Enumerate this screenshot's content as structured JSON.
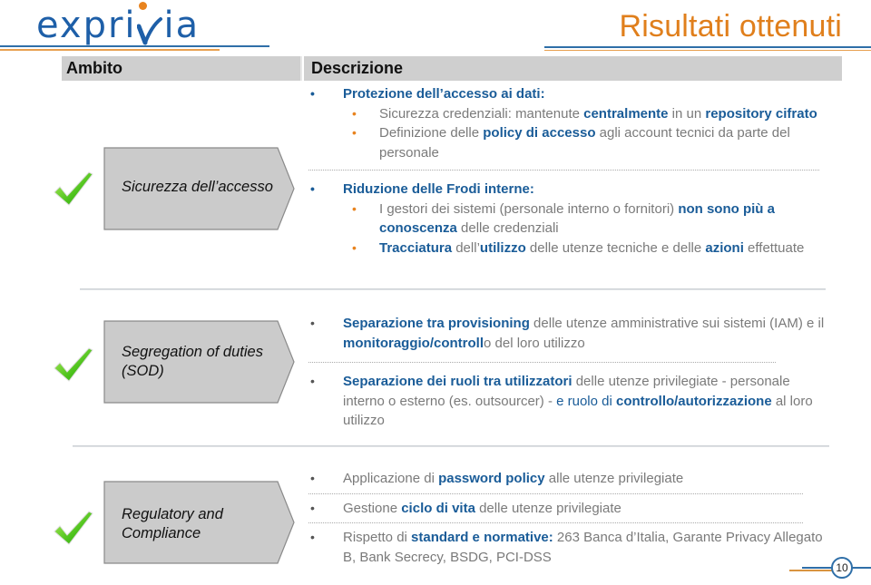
{
  "header": {
    "logo_text": "expri",
    "logo_text_end": "ia",
    "title": "Risultati ottenuti"
  },
  "table_header": {
    "ambito": "Ambito",
    "descrizione": "Descrizione"
  },
  "rows": [
    {
      "ambito": "Sicurezza dell’accesso",
      "status_icon": "check-icon",
      "groups": [
        {
          "title": "Protezione dell’accesso ai dati:",
          "items": [
            [
              {
                "t": "Sicurezza credenziali: mantenute "
              },
              {
                "t": "centralmente",
                "b": true
              },
              {
                "t": " in un "
              },
              {
                "t": "repository cifrato",
                "b": true
              }
            ],
            [
              {
                "t": "Definizione delle "
              },
              {
                "t": "policy di accesso",
                "b": true
              },
              {
                "t": " agli account tecnici da parte del personale"
              }
            ]
          ]
        },
        {
          "title": "Riduzione delle Frodi interne:",
          "items": [
            [
              {
                "t": "I gestori dei sistemi (personale interno o fornitori) "
              },
              {
                "t": "non sono più a conoscenza",
                "b": true
              },
              {
                "t": " delle credenziali"
              }
            ],
            [
              {
                "t": "Tracciatura",
                "b": true
              },
              {
                "t": " dell’"
              },
              {
                "t": "utilizzo",
                "b": true
              },
              {
                "t": " delle utenze tecniche e delle "
              },
              {
                "t": "azioni",
                "b": true
              },
              {
                "t": " effettuate"
              }
            ]
          ]
        }
      ]
    },
    {
      "ambito_line1": "Segregation of duties",
      "ambito_line2": "(SOD)",
      "status_icon": "check-icon",
      "bullets": [
        [
          {
            "t": "Separazione tra provisioning",
            "b": true
          },
          {
            "t": " delle utenze amministrative sui sistemi (IAM) e il "
          },
          {
            "t": "monitoraggio/controll",
            "b": true
          },
          {
            "t": "o del loro utilizzo"
          }
        ],
        [
          {
            "t": "Separazione dei ruoli tra utilizzatori",
            "b": true
          },
          {
            "t": " delle utenze privilegiate - personale interno o esterno (es. outsourcer) - "
          },
          {
            "t": "e ruolo di ",
            "c": "#1a5c98"
          },
          {
            "t": "controllo/autorizzazione",
            "b": true
          },
          {
            "t": " al loro utilizzo"
          }
        ]
      ]
    },
    {
      "ambito_line1": "Regulatory and",
      "ambito_line2": "Compliance",
      "status_icon": "check-icon",
      "bullets": [
        [
          {
            "t": "Applicazione di "
          },
          {
            "t": "password policy",
            "b": true
          },
          {
            "t": " alle utenze privilegiate"
          }
        ],
        [
          {
            "t": "Gestione "
          },
          {
            "t": "ciclo di vita",
            "b": true
          },
          {
            "t": " delle utenze privilegiate"
          }
        ],
        [
          {
            "t": "Rispetto di "
          },
          {
            "t": "standard e normative:",
            "b": true
          },
          {
            "t": " 263 Banca d’Italia, Garante Privacy Allegato B, Bank Secrecy, BSDG, PCI-DSS"
          }
        ]
      ]
    }
  ],
  "footer": {
    "page_number": "10"
  },
  "colors": {
    "accent_orange": "#e07f1c",
    "accent_blue": "#1a5c98",
    "header_gray": "#cfcfcf"
  }
}
